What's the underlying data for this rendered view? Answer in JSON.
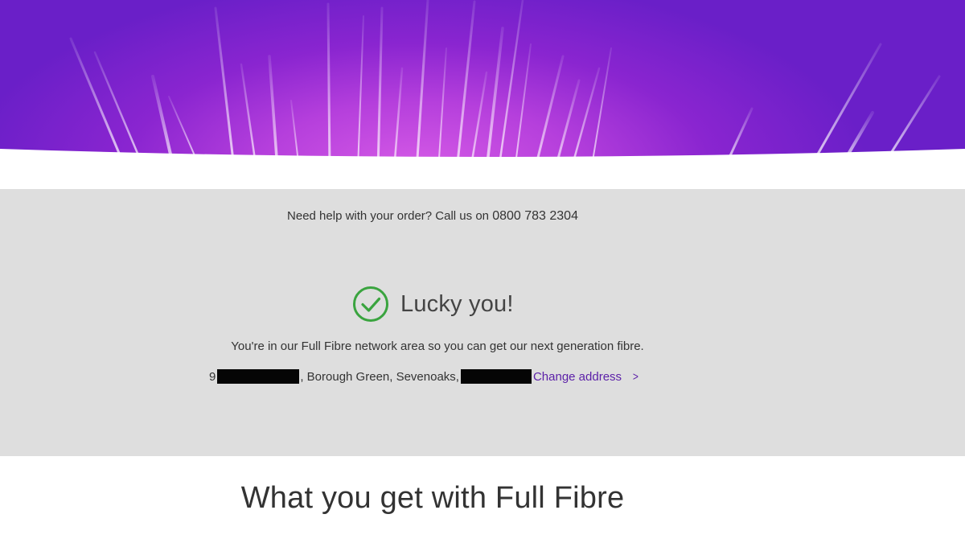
{
  "help": {
    "prefix": "Need help with your order? Call us on",
    "phone": "0800 783 2304"
  },
  "result": {
    "icon": "check-circle-icon",
    "title": "Lucky you!",
    "subtitle": "You're in our Full Fibre network area so you can get our next generation fibre.",
    "address_start": "9",
    "address_middle": ", Borough Green, Sevenoaks,",
    "change_label": "Change address",
    "change_icon": "chevron-right-icon"
  },
  "section": {
    "heading": "What you get with Full Fibre"
  },
  "colors": {
    "brand_purple": "#6a1fc8",
    "link_purple": "#5b1fa8",
    "success_green": "#3aa43f",
    "banner_grey": "#dedede"
  }
}
